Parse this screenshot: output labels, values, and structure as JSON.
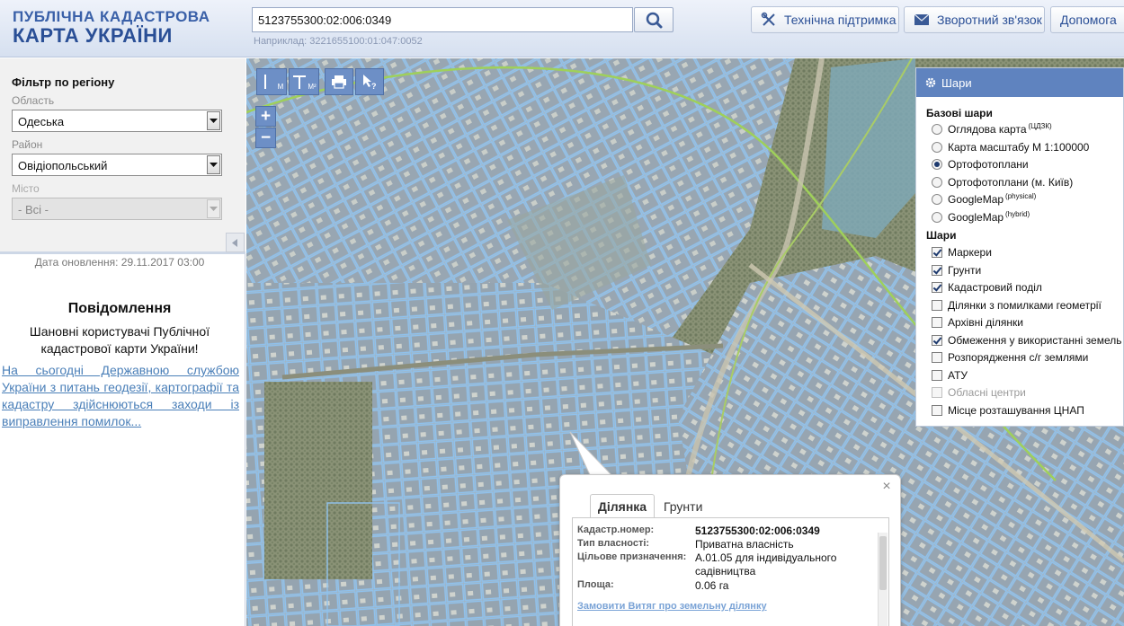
{
  "header": {
    "logo_line1": "ПУБЛІЧНА КАДАСТРОВА",
    "logo_line2": "КАРТА УКРАЇНИ",
    "search_value": "5123755300:02:006:0349",
    "search_example": "Наприклад: 3221655100:01:047:0052",
    "support_label": "Технічна підтримка",
    "feedback_label": "Зворотний зв'язок",
    "help_label": "Допомога",
    "icons": {
      "search": "search-icon",
      "support": "tools-icon",
      "feedback": "envelope-icon"
    }
  },
  "filter": {
    "title": "Фільтр по регіону",
    "region_label": "Область",
    "region_value": "Одеська",
    "district_label": "Район",
    "district_value": "Овідіопольський",
    "city_label": "Місто",
    "city_value": "- Всі -"
  },
  "update_date": "Дата оновлення: 29.11.2017 03:00",
  "news": {
    "title": "Повідомлення",
    "greeting": "Шановні користувачі Публічної кадастрової карти України!",
    "link_text": "На сьогодні Державною службою України з питань геодезії, картографії та кадастру здійснюються заходи із виправлення помилок..."
  },
  "map_tools": {
    "measure_length": "М",
    "measure_area": "М²",
    "zoom_in": "+",
    "zoom_out": "−"
  },
  "layers": {
    "title": "Шари",
    "base_title": "Базові шари",
    "base": [
      {
        "label": "Оглядова карта",
        "sup": "(ЦДЗК)",
        "selected": false
      },
      {
        "label": "Карта масштабу М 1:100000",
        "sup": "",
        "selected": false
      },
      {
        "label": "Ортофотоплани",
        "sup": "",
        "selected": true
      },
      {
        "label": "Ортофотоплани (м. Київ)",
        "sup": "",
        "selected": false
      },
      {
        "label": "GoogleMap",
        "sup": "(physical)",
        "selected": false
      },
      {
        "label": "GoogleMap",
        "sup": "(hybrid)",
        "selected": false
      }
    ],
    "overlay_title": "Шари",
    "overlays": [
      {
        "label": "Маркери",
        "checked": true,
        "disabled": false
      },
      {
        "label": "Грунти",
        "checked": true,
        "disabled": false
      },
      {
        "label": "Кадастровий поділ",
        "checked": true,
        "disabled": false
      },
      {
        "label": "Ділянки з помилками геометрії",
        "checked": false,
        "disabled": false
      },
      {
        "label": "Архівні ділянки",
        "checked": false,
        "disabled": false
      },
      {
        "label": "Обмеження у використанні земель",
        "checked": true,
        "disabled": false
      },
      {
        "label": "Розпорядження с/г землями",
        "checked": false,
        "disabled": false
      },
      {
        "label": "АТУ",
        "checked": false,
        "disabled": false
      },
      {
        "label": "Обласні центри",
        "checked": false,
        "disabled": true
      },
      {
        "label": "Місце розташування ЦНАП",
        "checked": false,
        "disabled": false
      }
    ]
  },
  "popup": {
    "tab_parcel": "Ділянка",
    "tab_soils": "Грунти",
    "close": "×",
    "rows": [
      {
        "key": "Кадастр.номер:",
        "value": "5123755300:02:006:0349"
      },
      {
        "key": "Тип власності:",
        "value": "Приватна власність"
      },
      {
        "key": "Цільове призначення:",
        "value": "А.01.05 для індивідуального садівництва"
      },
      {
        "key": "Площа:",
        "value": "0.06 га"
      }
    ],
    "order_link": "Замовити Витяг про земельну ділянку"
  }
}
